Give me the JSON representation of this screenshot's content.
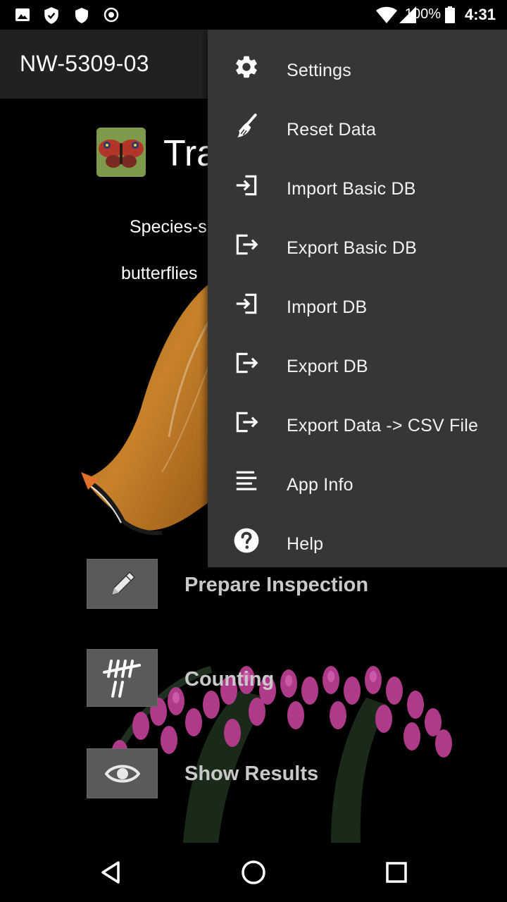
{
  "status_bar": {
    "battery_percent": "100%",
    "time": "4:31",
    "icons": [
      "image-icon",
      "shield-check-icon",
      "shield-icon",
      "record-icon",
      "wifi-icon",
      "cell-signal-icon",
      "battery-icon"
    ]
  },
  "app_bar": {
    "title": "NW-5309-03",
    "overflow_menu_open": true
  },
  "main": {
    "app_name_visible": "Tra",
    "subtitle_line_1_visible": "Species-s",
    "subtitle_line_2_visible": "butterflies",
    "buttons": [
      {
        "label": "Prepare Inspection",
        "icon": "pencil-icon"
      },
      {
        "label": "Counting",
        "icon": "tally-icon"
      },
      {
        "label": "Show Results",
        "icon": "eye-icon"
      }
    ]
  },
  "menu": {
    "items": [
      {
        "label": "Settings",
        "icon": "gear-icon"
      },
      {
        "label": "Reset Data",
        "icon": "broom-icon"
      },
      {
        "label": "Import Basic DB",
        "icon": "import-icon"
      },
      {
        "label": "Export Basic DB",
        "icon": "export-icon"
      },
      {
        "label": "Import DB",
        "icon": "import-icon"
      },
      {
        "label": "Export DB",
        "icon": "export-icon"
      },
      {
        "label": "Export Data -> CSV File",
        "icon": "export-icon"
      },
      {
        "label": "App Info",
        "icon": "text-lines-icon"
      },
      {
        "label": "Help",
        "icon": "help-icon"
      }
    ]
  },
  "nav_bar": {
    "buttons": [
      "back-icon",
      "home-icon",
      "recents-icon"
    ]
  },
  "colors": {
    "app_bar_bg": "#212121",
    "menu_bg": "#363636",
    "button_bg": "#5a5a5a",
    "button_label": "#c9c9c9"
  }
}
